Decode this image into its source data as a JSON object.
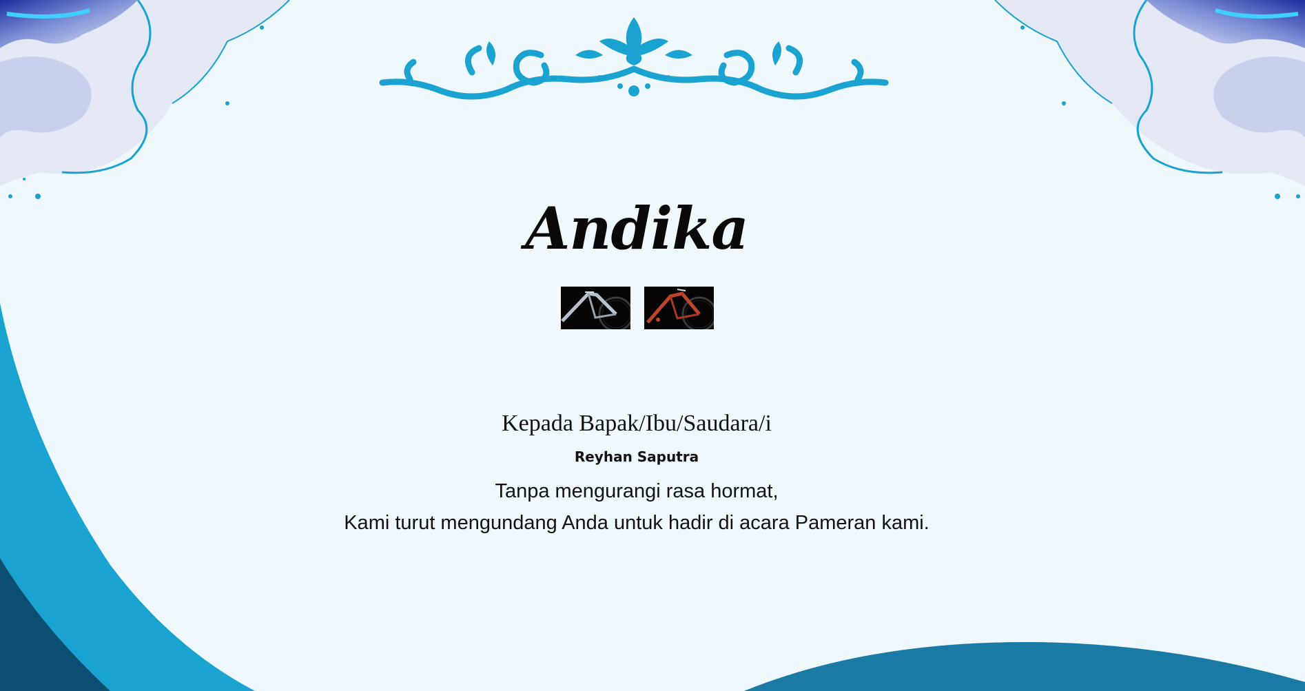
{
  "invitation": {
    "host_name": "Andika",
    "greeting": "Kepada Bapak/Ibu/Saudara/i",
    "guest_name": "Reyhan Saputra",
    "message_line1": "Tanpa mengurangi rasa hormat,",
    "message_line2": "Kami turut mengundang Anda untuk hadir di acara Pameran kami."
  },
  "gallery": {
    "thumbnails": [
      {
        "subject": "silver-road-bike"
      },
      {
        "subject": "red-road-bike"
      }
    ]
  },
  "colors": {
    "background": "#eef8fd",
    "accent": "#1aa3d0",
    "dark_wave": "#0c4f72",
    "mid_wave": "#1a7aa6"
  }
}
